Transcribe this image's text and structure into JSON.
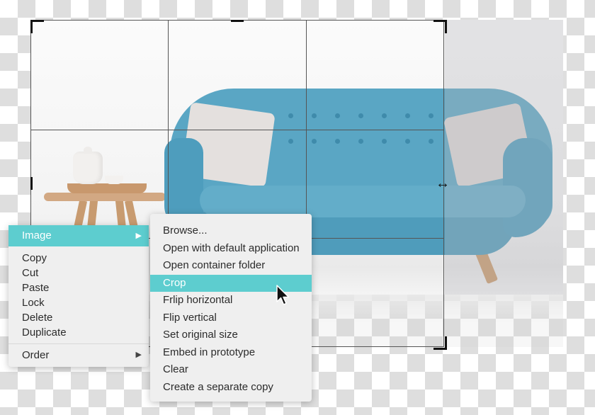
{
  "canvas": {
    "image_subject": "Blue tufted sofa with pillows and a wooden side table with teapot",
    "colors": {
      "accent": "#5dcdcf",
      "sofa": "#5aa6c4",
      "menu_bg": "#efefef",
      "checker": "#dedede"
    }
  },
  "crop_tool": {
    "resize_cursor_icon": "horizontal-resize-cursor"
  },
  "context_menu": {
    "items": [
      {
        "label": "Image",
        "has_submenu": true,
        "active": true
      },
      {
        "label": "Copy"
      },
      {
        "label": "Cut"
      },
      {
        "label": "Paste"
      },
      {
        "label": "Lock"
      },
      {
        "label": "Delete"
      },
      {
        "label": "Duplicate"
      },
      {
        "label": "Order",
        "has_submenu": true
      }
    ],
    "submenu_arrow": "▶"
  },
  "image_submenu": {
    "items": [
      {
        "label": "Browse..."
      },
      {
        "label": "Open with default application"
      },
      {
        "label": "Open container folder"
      },
      {
        "label": "Crop",
        "active": true
      },
      {
        "label": "Frlip horizontal"
      },
      {
        "label": "Flip vertical"
      },
      {
        "label": "Set original size"
      },
      {
        "label": "Embed in prototype"
      },
      {
        "label": "Clear"
      },
      {
        "label": "Create a separate copy"
      }
    ]
  }
}
